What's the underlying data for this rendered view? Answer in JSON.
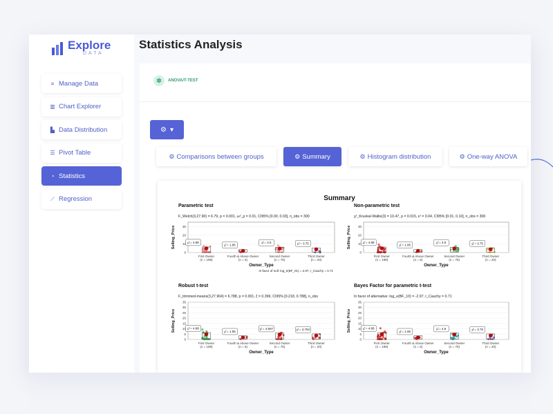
{
  "app": {
    "logo_main": "Explore",
    "logo_sub": "DATA",
    "page_title": "Statistics Analysis"
  },
  "sidebar": {
    "items": [
      {
        "label": "Manage Data",
        "icon": "database-icon",
        "glyph": "≡",
        "active": false
      },
      {
        "label": "Chart Explorer",
        "icon": "bar-chart-icon",
        "glyph": "▥",
        "active": false
      },
      {
        "label": "Data Distribution",
        "icon": "area-chart-icon",
        "glyph": "▙",
        "active": false
      },
      {
        "label": "Pivot Table",
        "icon": "list-icon",
        "glyph": "☰",
        "active": false
      },
      {
        "label": "Statistics",
        "icon": "pie-chart-icon",
        "glyph": "◔",
        "active": true
      },
      {
        "label": "Regression",
        "icon": "line-chart-icon",
        "glyph": "⟋",
        "active": false
      }
    ]
  },
  "panel": {
    "tag_label": "ANOVA/T-TEST",
    "settings_caret": "▾"
  },
  "tabs": [
    {
      "label": "Comparisons between groups",
      "active": false
    },
    {
      "label": "Summary",
      "active": true
    },
    {
      "label": "Histogram distribution",
      "active": false
    },
    {
      "label": "One-way ANOVA",
      "active": false
    }
  ],
  "colors": {
    "accent": "#5563d6",
    "tag_green": "#2a9c6a",
    "point_red": "#cc2222",
    "point_pink": "#e88a8a",
    "point_green": "#4aa55a",
    "point_teal": "#2aa8a0",
    "point_yellow": "#e0c020",
    "point_purple": "#6a4aa0"
  },
  "chart_data": {
    "type": "scatter",
    "title": "Summary",
    "panels": [
      {
        "title": "Parametric test",
        "stat_text": "F_Welch(3,27.90) = 6.79, p = 0.001, ω²_p = 0.01, CI95% [0.00, 0.03], n_obs = 300",
        "xlabel": "Owner_Type",
        "ylabel": "Selling_Price",
        "categories": [
          "First Owner",
          "Fourth & Above Owner",
          "Second Owner",
          "Third Owner"
        ],
        "n_labels": [
          "(n = 199)",
          "(n = 6)",
          "(n = 75)",
          "(n = 20)"
        ],
        "means": [
          "μ̂ = 4.88",
          "μ̂ = 1.95",
          "μ̂ = 4.6",
          "μ̂ = 3.75"
        ],
        "mean_values": [
          4.88,
          1.95,
          4.6,
          3.75
        ],
        "yticks": [
          0,
          10,
          20,
          30
        ],
        "ylim": [
          0,
          35
        ],
        "footnote": "In favor of null: log_e(BF_01) = 2.97, r_Cauchy = 0.71"
      },
      {
        "title": "Non-parametric test",
        "stat_text": "χ²_Kruskal-Wallis(3) = 10.47, p = 0.015, ε² = 0.04, CI95% [0.01, 0.10], n_obs = 300",
        "xlabel": "Owner_Type",
        "ylabel": "Selling_Price",
        "categories": [
          "First Owner",
          "Fourth & Above Owner",
          "Second Owner",
          "Third Owner"
        ],
        "n_labels": [
          "(n = 199)",
          "(n = 6)",
          "(n = 75)",
          "(n = 20)"
        ],
        "means": [
          "μ̂ = 4.88",
          "μ̂ = 1.95",
          "μ̂ = 4.6",
          "μ̂ = 3.75"
        ],
        "mean_values": [
          4.88,
          1.95,
          4.6,
          3.75
        ],
        "yticks": [
          0,
          10,
          20,
          30
        ],
        "ylim": [
          0,
          35
        ]
      },
      {
        "title": "Robust t-test",
        "stat_text": "F_trimmed-means(3,27.904) = 6.788, p = 0.001, ξ = 0.399, CI95% [0.218, 0.788], n_obs",
        "xlabel": "Owner_Type",
        "ylabel": "Selling_Price",
        "categories": [
          "First Owner",
          "Fourth & Above Owner",
          "Second Owner",
          "Third Owner"
        ],
        "n_labels": [
          "(n = 199)",
          "(n = 6)",
          "(n = 75)",
          "(n = 20)"
        ],
        "means": [
          "μ̂ = 4.88",
          "μ̂ = 1.95",
          "μ̂ = 4.597",
          "μ̂ = 3.753"
        ],
        "mean_values": [
          4.88,
          1.95,
          4.597,
          3.753
        ],
        "yticks": [
          0,
          5,
          10,
          15,
          20,
          25,
          30,
          35
        ],
        "ylim": [
          0,
          35
        ]
      },
      {
        "title": "Bayes Factor for parametric t-test",
        "stat_text": "In favor of alternative: log_e(BF_10) = -2.97, r_Cauchy = 0.71",
        "xlabel": "Owner_Type",
        "ylabel": "Selling_Price",
        "categories": [
          "First Owner",
          "Fourth & Above Owner",
          "Second Owner",
          "Third Owner"
        ],
        "n_labels": [
          "(n = 199)",
          "(n = 6)",
          "(n = 75)",
          "(n = 20)"
        ],
        "means": [
          "μ̂ = 4.88",
          "μ̂ = 1.95",
          "μ̂ = 4.6",
          "μ̂ = 3.75"
        ],
        "mean_values": [
          4.88,
          1.95,
          4.6,
          3.75
        ],
        "yticks": [
          0,
          5,
          10,
          15,
          20,
          25,
          30,
          35
        ],
        "ylim": [
          0,
          35
        ]
      }
    ]
  }
}
